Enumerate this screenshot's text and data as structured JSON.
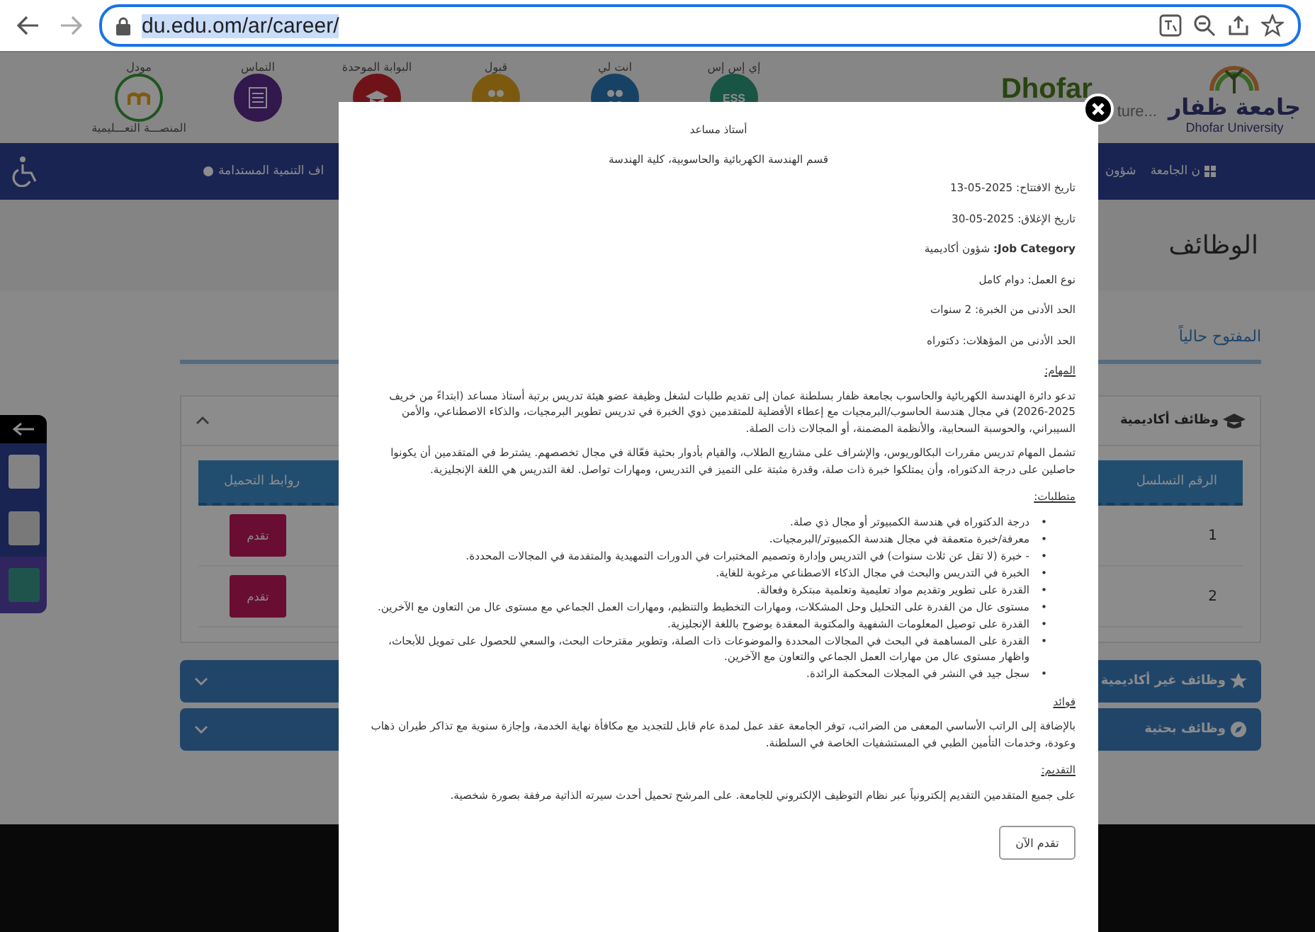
{
  "browser": {
    "url": "du.edu.om/ar/career/"
  },
  "site": {
    "shortcuts": [
      {
        "caption": "إي إس إس",
        "badge": "ESS",
        "kind": "badge"
      },
      {
        "caption": "انت لي",
        "kind": "people"
      },
      {
        "caption": "قبول",
        "kind": "admission"
      },
      {
        "caption": "البوابة الموحدة",
        "kind": "cap"
      },
      {
        "caption": "التماس",
        "kind": "list"
      },
      {
        "caption": "مودل",
        "subcaption": "المنصـــة التعـــليمية",
        "kind": "moodle"
      }
    ],
    "logo": {
      "english": "Dhofar",
      "tagline": "ture...",
      "arabic": "جامعة ظفار",
      "english_small": "Dhofar University"
    },
    "nav": [
      "ن الجامعة",
      "شؤون",
      "اف التنمية المستدامة"
    ]
  },
  "page": {
    "title": "الوظائف",
    "tab": {
      "label": "المفتوح حالياً",
      "selected": true
    },
    "sections": [
      {
        "title": "وظائف أكاديمية",
        "kind": "academic",
        "expanded": true,
        "table": {
          "columns": [
            "الرقم التسلسل",
            "روابط التحميل"
          ],
          "rows": [
            {
              "number": "1",
              "action": "تقدم"
            },
            {
              "number": "2",
              "action": "تقدم"
            }
          ]
        }
      },
      {
        "title": "وظائف غير أكاديمية",
        "kind": "star",
        "expanded": false
      },
      {
        "title": "وظائف بحثية",
        "kind": "research",
        "expanded": false
      }
    ]
  },
  "modal": {
    "title": "أستاذ مساعد",
    "department": "قسم الهندسة الكهربائية والحاسوبية، كلية الهندسة",
    "fields": [
      "تاريخ الافتتاح: 2025-05-13",
      "تاريخ الإغلاق: 2025-05-30",
      "**Job Category:** شؤون أكاديمية",
      "نوع العمل: دوام كامل",
      "الحد الأدنى من الخبرة: 2 سنوات",
      "الحد الأدنى من المؤهلات: دكتوراه"
    ],
    "sections": [
      {
        "heading": "المهام:",
        "paragraphs": [
          "تدعو دائرة الهندسة الكهربائية والحاسوب بجامعة ظفار بسلطنة عمان إلى تقديم طلبات لشغل وظيفة عضو هيئة تدريس برتبة أستاذ مساعد (ابتداءً من خريف 2025-2026) في مجال هندسة الحاسوب/البرمجيات مع إعطاء الأفضلية للمتقدمين ذوي الخبرة في تدريس تطوير البرمجيات، والذكاء الاصطناعي، والأمن السيبراني، والحوسبة السحابية، والأنظمة المضمنة، أو المجالات ذات الصلة.",
          "تشمل المهام تدريس مقررات البكالوريوس، والإشراف على مشاريع الطلاب، والقيام بأدوار بحثية فعّالة في مجال تخصصهم. يشترط في المتقدمين أن يكونوا حاصلين على درجة الدكتوراه، وأن يمتلكوا خبرة ذات صلة، وقدرة مثبتة على التميز في التدريس، ومهارات تواصل. لغة التدريس هي اللغة الإنجليزية."
        ]
      },
      {
        "heading": "متطلبات:",
        "marker": "•",
        "items": [
          "درجة الدكتوراه في هندسة الكمبيوتر أو مجال ذي صلة.",
          "معرفة/خبرة متعمقة في مجال هندسة الكمبيوتر/البرمجيات.",
          "- خبرة (لا تقل عن ثلاث سنوات) في التدريس وإدارة وتصميم المختبرات في الدورات التمهيدية والمتقدمة في المجالات المحددة.",
          "الخبرة في التدريس والبحث في مجال الذكاء الاصطناعي مرغوبة للغاية.",
          "القدرة على تطوير وتقديم مواد تعليمية وتعلمية مبتكرة وفعالة.",
          "مستوى عال من القدرة على التحليل وحل المشكلات، ومهارات التخطيط والتنظيم، ومهارات العمل الجماعي مع مستوى عال من التعاون مع الآخرين.",
          "القدرة على توصيل المعلومات الشفهية والمكتوبة المعقدة بوضوح باللغة الإنجليزية.",
          "القدرة على المساهمة في البحث في المجالات المحددة والموضوعات ذات الصلة، وتطوير مقترحات البحث، والسعي للحصول على تمويل للأبحاث، واظهار مستوى عال من مهارات العمل الجماعي والتعاون مع الآخرين.",
          "سجل جيد في النشر في المجلات المحكمة الرائدة."
        ]
      },
      {
        "heading": "فوائد",
        "paragraphs": [
          "بالإضافة إلى الراتب الأساسي المعفى من الضرائب، توفر الجامعة عقد عمل لمدة عام قابل للتجديد مع مكافأة نهاية الخدمة، وإجازة سنوية مع تذاكر طيران ذهاب وعودة، وخدمات التأمين الطبي في المستشفيات الخاصة في السلطنة."
        ]
      },
      {
        "heading": "التقديم:",
        "paragraphs": [
          "على جميع المتقدمين التقديم إلكترونياً عبر نظام التوظيف الإلكتروني للجامعة. على المرشح تحميل أحدث سيرته الذاتية مرفقة بصورة شخصية."
        ]
      }
    ],
    "button": "تقدم الآن"
  }
}
